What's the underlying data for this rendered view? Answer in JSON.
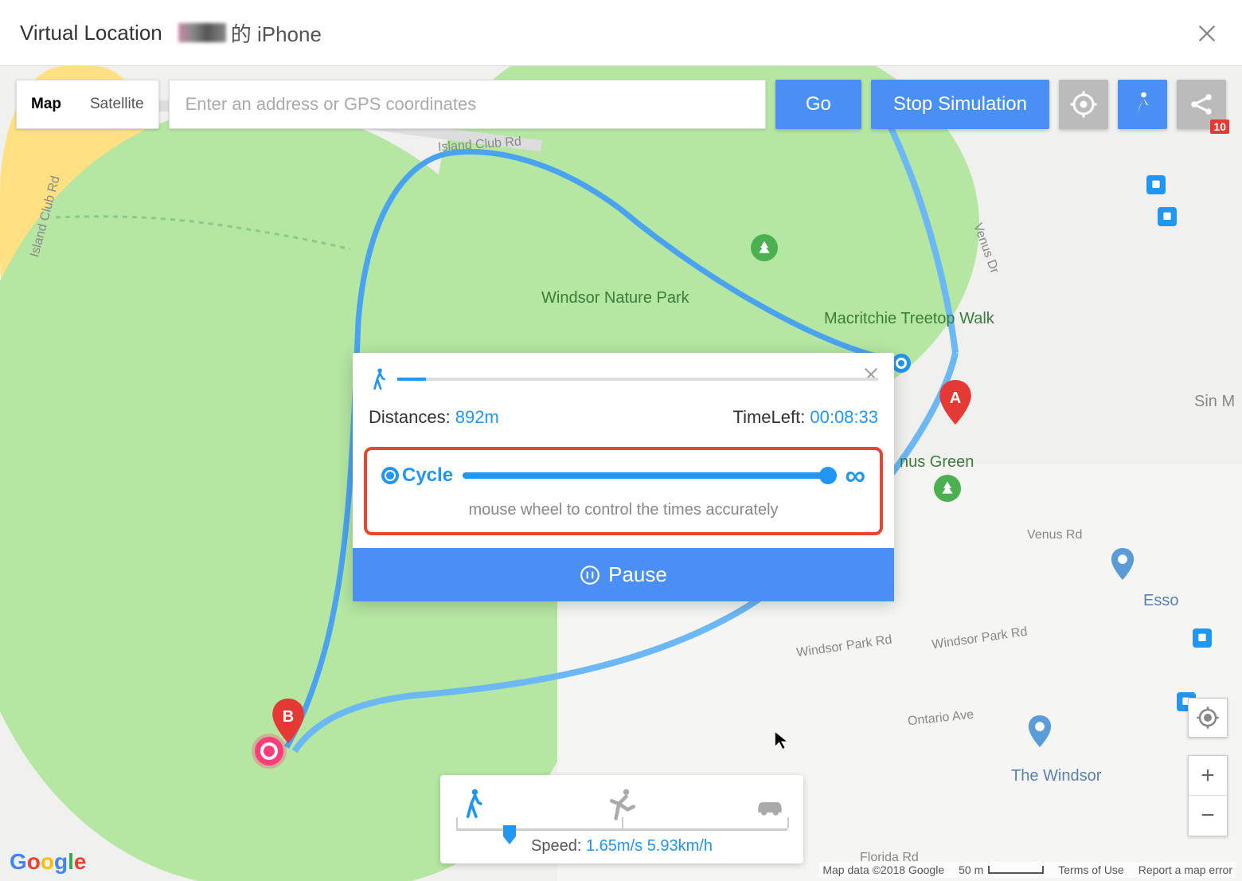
{
  "header": {
    "title": "Virtual Location",
    "device_suffix": "的 iPhone"
  },
  "toolbar": {
    "map_tab": "Map",
    "satellite_tab": "Satellite",
    "search_placeholder": "Enter an address or GPS coordinates",
    "go": "Go",
    "stop": "Stop Simulation",
    "history_badge": "10"
  },
  "map": {
    "poi": {
      "windsor_park": "Windsor Nature Park",
      "treetop_walk": "Macritchie Treetop Walk",
      "nus_green": "nus Green",
      "the_windsor": "The Windsor",
      "esso": "Esso",
      "sin_m": "Sin M"
    },
    "roads": {
      "island_club": "Island Club Rd",
      "venus_dr": "Venus Dr",
      "venus_rd": "Venus Rd",
      "windsor_park_rd": "Windsor Park Rd",
      "ontario_ave": "Ontario Ave",
      "florida_rd": "Florida Rd",
      "island_club_rd2": "Island Club Rd"
    },
    "markers": {
      "a": "A",
      "b": "B"
    }
  },
  "popup": {
    "distances_label": "Distances:",
    "distances_value": "892m",
    "timeleft_label": "TimeLeft:",
    "timeleft_value": "00:08:33",
    "cycle_label": "Cycle",
    "infinity": "∞",
    "hint": "mouse wheel to control the times accurately",
    "pause": "Pause"
  },
  "speed": {
    "label": "Speed:",
    "ms": "1.65m/s",
    "kmh": "5.93km/h",
    "slider_pct": 16
  },
  "zoom": {
    "in": "+",
    "out": "−"
  },
  "attribution": {
    "mapdata": "Map data ©2018 Google",
    "scale": "50 m",
    "terms": "Terms of Use",
    "report": "Report a map error"
  },
  "logo": "Google"
}
